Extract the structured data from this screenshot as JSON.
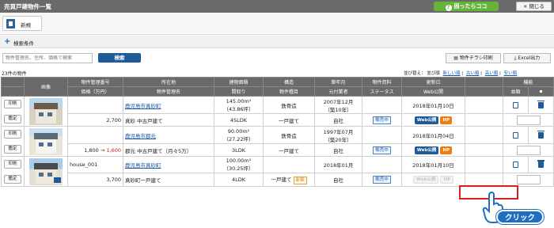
{
  "window": {
    "title": "売買戸建物件一覧",
    "help_label": "困ったらココ",
    "help_glyph": "?",
    "close_label": "× 閉じる"
  },
  "toolbar": {
    "new_label": "新規"
  },
  "search_section": {
    "toggle_glyph": "+",
    "label": "検索条件"
  },
  "search": {
    "placeholder": "物件管理名、住所、価格で検索",
    "button_label": "検索",
    "flyer_label": "物件チラシ印刷",
    "excel_label": "Excel出力"
  },
  "list": {
    "count_text": "23件の物件",
    "sort_label": "並び替え：",
    "sort_options": [
      "並び順",
      "新しい順",
      "古い順",
      "高い順",
      "安い順"
    ],
    "header_top": [
      "画像",
      "物件管理番号",
      "所在地",
      "建物面積",
      "構造",
      "築年月",
      "物件資料",
      "更新日",
      "機能"
    ],
    "header_bottom": [
      "価格（万円）",
      "物件管理名",
      "間取り",
      "物件種目",
      "元付業者",
      "ステータス",
      "Web公開",
      "並順"
    ],
    "row_buttons": [
      "印刷",
      "鑑定"
    ],
    "properties": [
      {
        "id": "",
        "location": "鹿児島市真砂町",
        "area": "145.00m²",
        "area_tsubo": "（43.86坪）",
        "structure": "鉄骨造",
        "built": "2007年12月",
        "built_age": "（築10年）",
        "updated": "2018年01月10日",
        "price": "2,700",
        "name": "真砂 中古戸建て",
        "layout": "4SLDK",
        "type": "一戸建て",
        "dealer": "自社",
        "status": "販売中",
        "web_label": "Web公開",
        "hp_label": "HP",
        "web_public": true
      },
      {
        "id": "",
        "location": "鹿児島市郡元",
        "area": "90.00m²",
        "area_tsubo": "（27.22坪）",
        "structure": "鉄骨造",
        "built": "1997年07月",
        "built_age": "（築20年）",
        "updated": "2018年01月04日",
        "price_old": "1,800",
        "price_arrow": "→",
        "price": "1,600",
        "name": "郡元 中古戸建て（月々5万）",
        "layout": "3LDK",
        "type": "一戸建て",
        "dealer": "自社",
        "status": "販売中",
        "web_label": "Web公開",
        "hp_label": "HP",
        "web_public": true
      },
      {
        "id": "house_001",
        "location": "鹿児島市真砂町",
        "area": "100.00m²",
        "area_tsubo": "（30.25坪）",
        "structure": "",
        "built": "2018年01月",
        "built_age": "",
        "updated": "2018年01月10日",
        "price": "3,700",
        "name": "真砂町一戸建て",
        "layout": "4LDK",
        "type": "一戸建て",
        "new_badge": "新築",
        "dealer": "自社",
        "status": "販売中",
        "web_label": "Web公開",
        "hp_label": "HP",
        "web_public": false
      }
    ]
  },
  "overlay": {
    "click_label": "クリック"
  },
  "colors": {
    "titlebar": "#6a6a6a",
    "accent": "#1f5b9b",
    "help": "#66b33b",
    "hp": "#ef7d0f",
    "price_new": "#d62020",
    "highlight": "#d42020"
  }
}
